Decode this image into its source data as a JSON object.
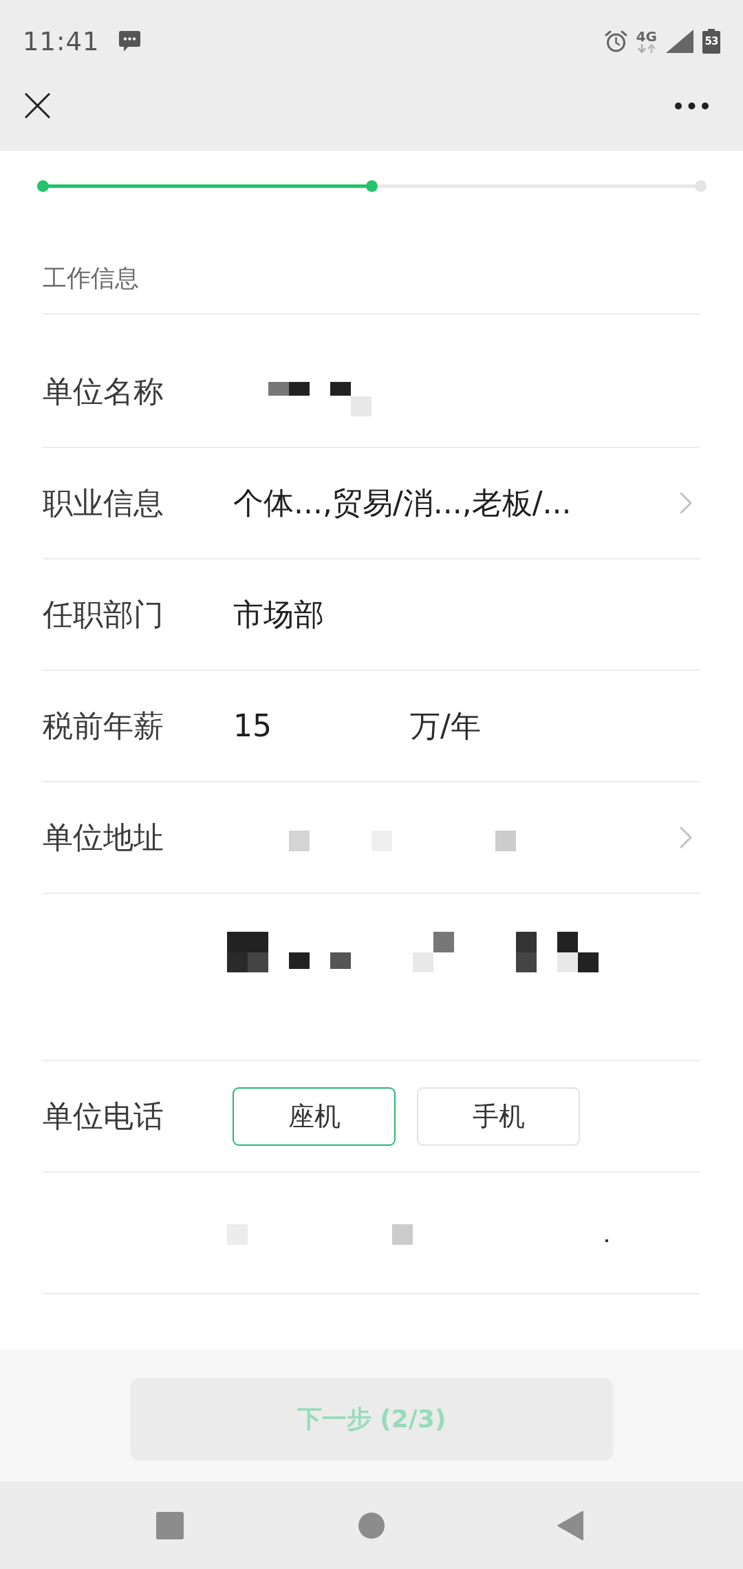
{
  "status_bar": {
    "time": "11:41",
    "network": "4G",
    "battery": "53"
  },
  "progress": {
    "level": 0.5
  },
  "section": {
    "title": "工作信息"
  },
  "rows": [
    {
      "kind": "text",
      "label": "单位名称",
      "redacted": true
    },
    {
      "kind": "select",
      "label": "职业信息",
      "value": "个体...,贸易/消...,老板/..."
    },
    {
      "kind": "text",
      "label": "任职部门",
      "value": "市场部"
    },
    {
      "kind": "amount",
      "label": "税前年薪",
      "value": "15",
      "unit": "万/年"
    },
    {
      "kind": "select",
      "label": "单位地址",
      "redacted": true
    },
    {
      "kind": "textarea",
      "redacted": true
    },
    {
      "kind": "choice",
      "label": "单位电话",
      "options": [
        {
          "label": "座机",
          "selected": true
        },
        {
          "label": "手机",
          "selected": false
        }
      ]
    },
    {
      "kind": "text",
      "redacted": true
    }
  ],
  "next_button": {
    "label": "下一步 (2/3)",
    "disabled": true
  }
}
